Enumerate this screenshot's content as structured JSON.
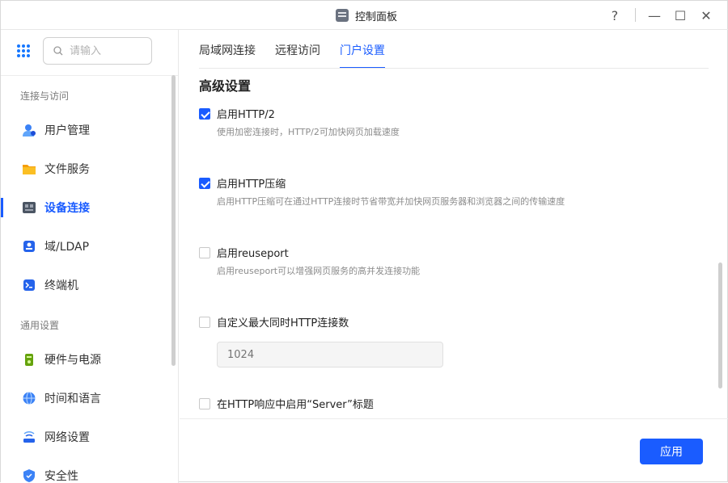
{
  "window": {
    "title": "控制面板"
  },
  "titlebar": {
    "help": "?",
    "minimize": "—",
    "maximize": "☐",
    "close": "✕"
  },
  "sidebar": {
    "search_placeholder": "请输入",
    "sections": [
      {
        "label": "连接与访问"
      },
      {
        "label": "通用设置"
      }
    ],
    "items": [
      {
        "label": "用户管理",
        "icon": "user-management-icon",
        "color": "#3b82f6"
      },
      {
        "label": "文件服务",
        "icon": "folder-icon",
        "color": "#f59e0b"
      },
      {
        "label": "设备连接",
        "icon": "device-connection-icon",
        "color": "#4b5563"
      },
      {
        "label": "域/LDAP",
        "icon": "domain-ldap-icon",
        "color": "#2563eb"
      },
      {
        "label": "终端机",
        "icon": "terminal-icon",
        "color": "#2563eb"
      },
      {
        "label": "硬件与电源",
        "icon": "hardware-power-icon",
        "color": "#84cc16"
      },
      {
        "label": "时间和语言",
        "icon": "globe-icon",
        "color": "#3b82f6"
      },
      {
        "label": "网络设置",
        "icon": "router-icon",
        "color": "#2563eb"
      },
      {
        "label": "安全性",
        "icon": "shield-icon",
        "color": "#3b82f6"
      }
    ],
    "active_item": "设备连接"
  },
  "main": {
    "tabs": [
      {
        "label": "局域网连接"
      },
      {
        "label": "远程访问"
      },
      {
        "label": "门户设置"
      }
    ],
    "active_tab": "门户设置",
    "section_title": "高级设置",
    "options": [
      {
        "label": "启用HTTP/2",
        "checked": true,
        "description": "使用加密连接时，HTTP/2可加快网页加载速度"
      },
      {
        "label": "启用HTTP压缩",
        "checked": true,
        "description": "启用HTTP压缩可在通过HTTP连接时节省带宽并加快网页服务器和浏览器之间的传输速度"
      },
      {
        "label": "启用reuseport",
        "checked": false,
        "description": "启用reuseport可以增强网页服务的高并发连接功能"
      },
      {
        "label": "自定义最大同时HTTP连接数",
        "checked": false,
        "description": ""
      },
      {
        "label": "在HTTP响应中启用“Server”标题",
        "checked": false,
        "description": ""
      }
    ],
    "max_connections_placeholder": "1024"
  },
  "footer": {
    "apply_label": "应用"
  },
  "colors": {
    "accent": "#1a5cff"
  }
}
